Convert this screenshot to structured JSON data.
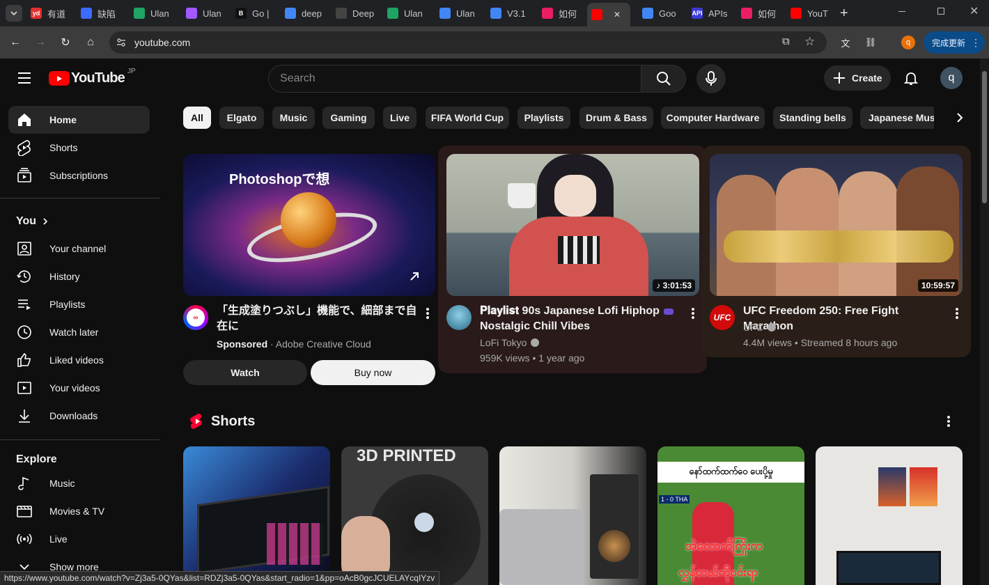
{
  "browser": {
    "tabs": [
      {
        "label": "有道",
        "fav": "yd",
        "color": "#e0312f"
      },
      {
        "label": "缺陷",
        "fav": "",
        "color": "#3b6cff"
      },
      {
        "label": "Ulan",
        "fav": "",
        "color": "#1fa463"
      },
      {
        "label": "Ulan",
        "fav": "",
        "color": "#a259ff"
      },
      {
        "label": "Go |",
        "fav": "B",
        "color": "#111"
      },
      {
        "label": "deep",
        "fav": "",
        "color": "#4285f4"
      },
      {
        "label": "Deep",
        "fav": "",
        "color": "#444"
      },
      {
        "label": "Ulan",
        "fav": "",
        "color": "#1fa463"
      },
      {
        "label": "Ulan",
        "fav": "",
        "color": "#4285f4"
      },
      {
        "label": "V3.1",
        "fav": "",
        "color": "#4285f4"
      },
      {
        "label": "如何",
        "fav": "",
        "color": "#e91e63"
      },
      {
        "label": "",
        "fav": "",
        "color": "#ff0000"
      },
      {
        "label": "Goo",
        "fav": "",
        "color": "#4285f4"
      },
      {
        "label": "APIs",
        "fav": "API",
        "color": "#3b3bd6"
      },
      {
        "label": "如何",
        "fav": "",
        "color": "#e91e63"
      },
      {
        "label": "YouT",
        "fav": "",
        "color": "#ff0000"
      }
    ],
    "url": "youtube.com",
    "update_label": "完成更新",
    "profile_initial": "q",
    "status_url": "https://www.youtube.com/watch?v=Zj3a5-0QYas&list=RDZj3a5-0QYas&start_radio=1&pp=oAcB0gcJCUELAYcqIYzv"
  },
  "header": {
    "logo": "YouTube",
    "region": "JP",
    "search_placeholder": "Search",
    "create_label": "Create",
    "avatar_initial": "q"
  },
  "sidebar": {
    "main": [
      {
        "label": "Home",
        "icon": "home-icon"
      },
      {
        "label": "Shorts",
        "icon": "shorts-icon"
      },
      {
        "label": "Subscriptions",
        "icon": "subscriptions-icon"
      }
    ],
    "you_heading": "You",
    "you": [
      {
        "label": "Your channel",
        "icon": "channel-icon"
      },
      {
        "label": "History",
        "icon": "history-icon"
      },
      {
        "label": "Playlists",
        "icon": "playlists-icon"
      },
      {
        "label": "Watch later",
        "icon": "clock-icon"
      },
      {
        "label": "Liked videos",
        "icon": "thumb-up-icon"
      },
      {
        "label": "Your videos",
        "icon": "play-icon"
      },
      {
        "label": "Downloads",
        "icon": "download-icon"
      }
    ],
    "explore_heading": "Explore",
    "explore": [
      {
        "label": "Music",
        "icon": "music-icon"
      },
      {
        "label": "Movies & TV",
        "icon": "film-icon"
      },
      {
        "label": "Live",
        "icon": "live-icon"
      },
      {
        "label": "Show more",
        "icon": "chevron-down-icon"
      }
    ]
  },
  "chips": [
    "All",
    "Elgato",
    "Music",
    "Gaming",
    "Live",
    "FIFA World Cup",
    "Playlists",
    "Drum & Bass",
    "Computer Hardware",
    "Standing bells",
    "Japanese Music"
  ],
  "videos": [
    {
      "title": "「生成塗りつぶし」機能で、細部まで自在に",
      "title_line1": "「生成塗りつぶし」機能で、細部まで自",
      "title_line2": "在に",
      "sponsored": "Sponsored",
      "advertiser": "Adobe Creative Cloud",
      "overlay_text": "Photoshopで想",
      "watch_label": "Watch",
      "buy_label": "Buy now"
    },
    {
      "title_line1": "𝐏𝐥𝐚𝐲𝐥𝐢𝐬𝐭 90s Japanese Lofi Hiphop",
      "title_line2": "Nostalgic Chill Vibes",
      "channel": "LoFi Tokyo",
      "meta": "959K views • 1 year ago",
      "duration": "3:01:53"
    },
    {
      "title": "UFC Freedom 250: Free Fight Marathon",
      "channel": "UFC",
      "channel_avatar": "UFC",
      "meta": "4.4M views • Streamed 8 hours ago",
      "duration": "10:59:57"
    }
  ],
  "shorts": {
    "heading": "Shorts",
    "items": [
      {
        "overlay": "",
        "bg": "#1a4a8a"
      },
      {
        "overlay": "3D PRINTED",
        "bg": "#2a2a2a"
      },
      {
        "overlay": "",
        "bg": "#6a6a6a"
      },
      {
        "overlay": "နော်ထက်ထက်ဝေ ပေးပို့မှု",
        "overlay2": "အဲလောက်ကြိုးက",
        "overlay3": "လွှန်တယ်ကိုဝင်းရာ",
        "score": "1 - 0 THA",
        "bg": "#3e7a2a"
      },
      {
        "overlay": "",
        "bg": "#d8d4cc"
      }
    ]
  },
  "colors": {
    "brand_red": "#ff0000",
    "bg": "#0f0f0f",
    "chip": "#272727",
    "accent_update": "#0b4b87"
  }
}
